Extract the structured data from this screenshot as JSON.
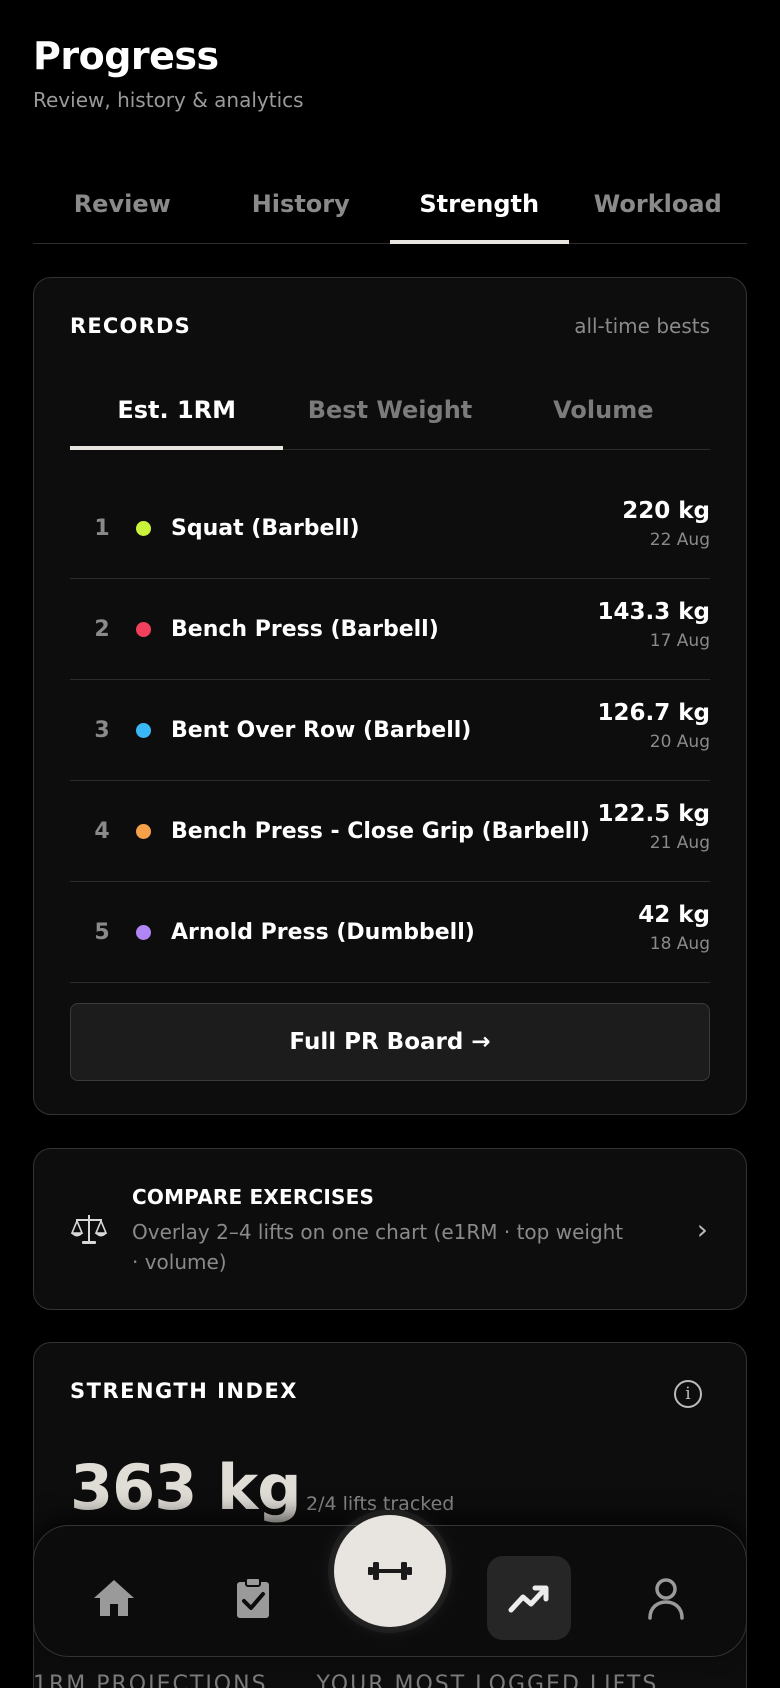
{
  "header": {
    "title": "Progress",
    "subtitle": "Review, history & analytics"
  },
  "tabs": [
    {
      "label": "Review",
      "active": false
    },
    {
      "label": "History",
      "active": false
    },
    {
      "label": "Strength",
      "active": true
    },
    {
      "label": "Workload",
      "active": false
    }
  ],
  "records": {
    "title": "RECORDS",
    "right_label": "all-time bests",
    "subtabs": [
      {
        "label": "Est. 1RM",
        "active": true
      },
      {
        "label": "Best Weight",
        "active": false
      },
      {
        "label": "Volume",
        "active": false
      }
    ],
    "items": [
      {
        "rank": "1",
        "name": "Squat (Barbell)",
        "weight": "220 kg",
        "date": "22 Aug",
        "color": "#c9f23a"
      },
      {
        "rank": "2",
        "name": "Bench Press (Barbell)",
        "weight": "143.3 kg",
        "date": "17 Aug",
        "color": "#f0405b"
      },
      {
        "rank": "3",
        "name": "Bent Over Row (Barbell)",
        "weight": "126.7 kg",
        "date": "20 Aug",
        "color": "#3ab8f5"
      },
      {
        "rank": "4",
        "name": "Bench Press - Close Grip (Barbell)",
        "weight": "122.5 kg",
        "date": "21 Aug",
        "color": "#f7a04a"
      },
      {
        "rank": "5",
        "name": "Arnold Press (Dumbbell)",
        "weight": "42 kg",
        "date": "18 Aug",
        "color": "#b085f5"
      }
    ],
    "button_label": "Full PR Board →"
  },
  "compare": {
    "icon": "scales-icon",
    "title": "COMPARE EXERCISES",
    "description": "Overlay 2–4 lifts on one chart (e1RM · top weight · volume)",
    "chevron": "›"
  },
  "strength_index": {
    "title": "STRENGTH INDEX",
    "info_icon": "i",
    "value": "363 kg",
    "subtext": "2/4 lifts tracked"
  },
  "bottom_labels": [
    "1RM PROJECTIONS",
    "YOUR MOST LOGGED LIFTS"
  ],
  "nav": {
    "items": [
      "home-icon",
      "clipboard-check-icon",
      "dumbbell-icon",
      "trending-up-icon",
      "profile-icon"
    ],
    "active": "trending-up-icon"
  }
}
